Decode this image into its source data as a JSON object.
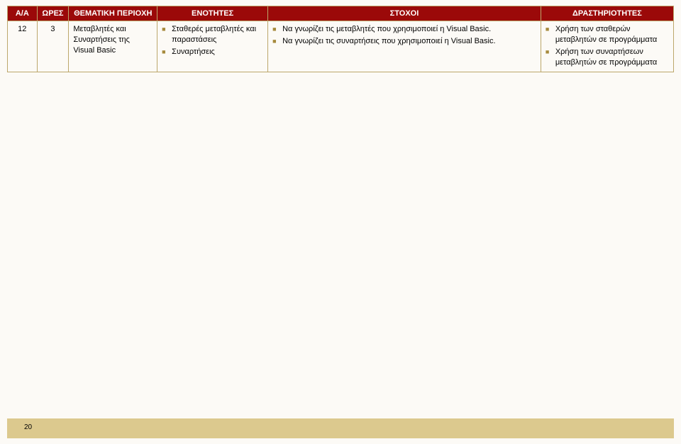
{
  "headers": {
    "aa": "Α/Α",
    "wres": "ΩΡΕΣ",
    "thematic": "ΘΕΜΑΤΙΚΗ ΠΕΡΙΟΧΗ",
    "enotites": "ΕΝΟΤΗΤΕΣ",
    "stoxoi": "ΣΤΟΧΟΙ",
    "drast": "ΔΡΑΣΤΗΡΙΟΤΗΤΕΣ"
  },
  "row": {
    "aa": "12",
    "wres": "3",
    "thematic": "Μεταβλητές και Συναρτήσεις της Visual Basic",
    "enotites": [
      "Σταθερές μεταβλητές και παραστάσεις",
      "Συναρτήσεις"
    ],
    "stoxoi": [
      "Να γνωρίζει τις μεταβλητές που χρησιμοποιεί η Visual Basic.",
      "Να γνωρίζει τις συναρτήσεις που χρησιμοποιεί η Visual Basic."
    ],
    "drast": [
      "Χρήση των σταθερών μεταβλητών σε προγράμματα",
      "Χρήση των συναρτήσεων μεταβλητών σε προγράμματα"
    ]
  },
  "page_number": "20"
}
